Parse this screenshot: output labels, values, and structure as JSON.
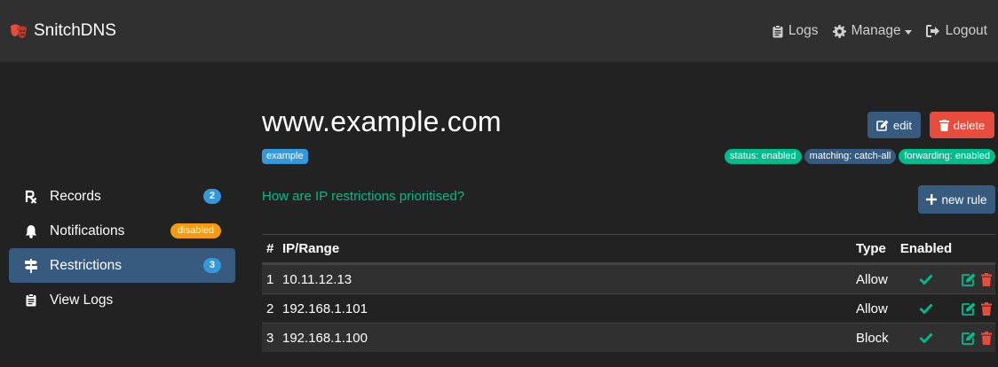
{
  "brand": {
    "name": "SnitchDNS",
    "icon": "masks-icon",
    "color": "#e74c3c"
  },
  "nav": {
    "logs": {
      "label": "Logs",
      "icon": "clipboard-icon"
    },
    "manage": {
      "label": "Manage",
      "icon": "gear-icon"
    },
    "logout": {
      "label": "Logout",
      "icon": "sign-out-icon"
    }
  },
  "sidebar": {
    "items": [
      {
        "label": "Records",
        "icon": "prescription-icon",
        "badge": "2",
        "active": false
      },
      {
        "label": "Notifications",
        "icon": "bell-icon",
        "badge": "disabled",
        "active": false
      },
      {
        "label": "Restrictions",
        "icon": "signs-icon",
        "badge": "3",
        "active": true
      },
      {
        "label": "View Logs",
        "icon": "clipboard-icon",
        "badge": "",
        "active": false
      }
    ]
  },
  "zone": {
    "title": "www.example.com",
    "tag": "example",
    "edit_label": "edit",
    "delete_label": "delete",
    "status": "status: enabled",
    "matching": "matching: catch-all",
    "forwarding": "forwarding: enabled"
  },
  "restrictions": {
    "help_link": "How are IP restrictions prioritised?",
    "new_rule_label": "new rule",
    "columns": {
      "num": "#",
      "ip": "IP/Range",
      "type": "Type",
      "enabled": "Enabled"
    },
    "rows": [
      {
        "num": "1",
        "ip": "10.11.12.13",
        "type": "Allow",
        "enabled": true
      },
      {
        "num": "2",
        "ip": "192.168.1.101",
        "type": "Allow",
        "enabled": true
      },
      {
        "num": "3",
        "ip": "192.168.1.100",
        "type": "Block",
        "enabled": true
      }
    ]
  },
  "colors": {
    "background": "#222222",
    "navbar": "#303030",
    "primary": "#375a7f",
    "success": "#00bc8c",
    "danger": "#e74c3c",
    "info": "#3498db",
    "warning": "#f39c12"
  }
}
